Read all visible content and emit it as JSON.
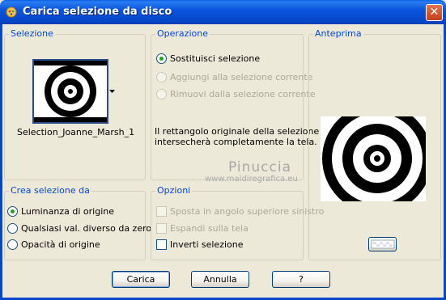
{
  "window": {
    "title": "Carica selezione da disco"
  },
  "selezione": {
    "label": "Selezione",
    "selection_name": "Selection_Joanne_Marsh_1"
  },
  "operazione": {
    "label": "Operazione",
    "options": [
      {
        "label": "Sostituisci selezione",
        "checked": true,
        "enabled": true
      },
      {
        "label": "Aggiungi alla selezione corrente",
        "checked": false,
        "enabled": false
      },
      {
        "label": "Rimuovi dalla selezione corrente",
        "checked": false,
        "enabled": false
      }
    ],
    "info_line1": "Il rettangolo originale della selezione",
    "info_line2": "intersecherà completamente la tela."
  },
  "anteprima": {
    "label": "Anteprima"
  },
  "crea": {
    "label": "Crea selezione da",
    "options": [
      {
        "label": "Luminanza di origine",
        "checked": true
      },
      {
        "label": "Qualsiasi val. diverso da zero",
        "checked": false
      },
      {
        "label": "Opacità di origine",
        "checked": false
      }
    ]
  },
  "opzioni": {
    "label": "Opzioni",
    "options": [
      {
        "label": "Sposta in angolo superiore sinistro",
        "checked": false,
        "enabled": false
      },
      {
        "label": "Espandi sulla tela",
        "checked": false,
        "enabled": false
      },
      {
        "label": "Inverti selezione",
        "checked": false,
        "enabled": true
      }
    ]
  },
  "buttons": {
    "ok": "Carica",
    "cancel": "Annulla",
    "help": "?"
  },
  "watermark": {
    "line1": "Pinuccia",
    "line2": "www.maidiregrafica.eu"
  },
  "colors": {
    "title_bar": "#0a55de",
    "group_label": "#0046d5",
    "radio_dot": "#21a121",
    "dialog_bg": "#ece9d8"
  }
}
